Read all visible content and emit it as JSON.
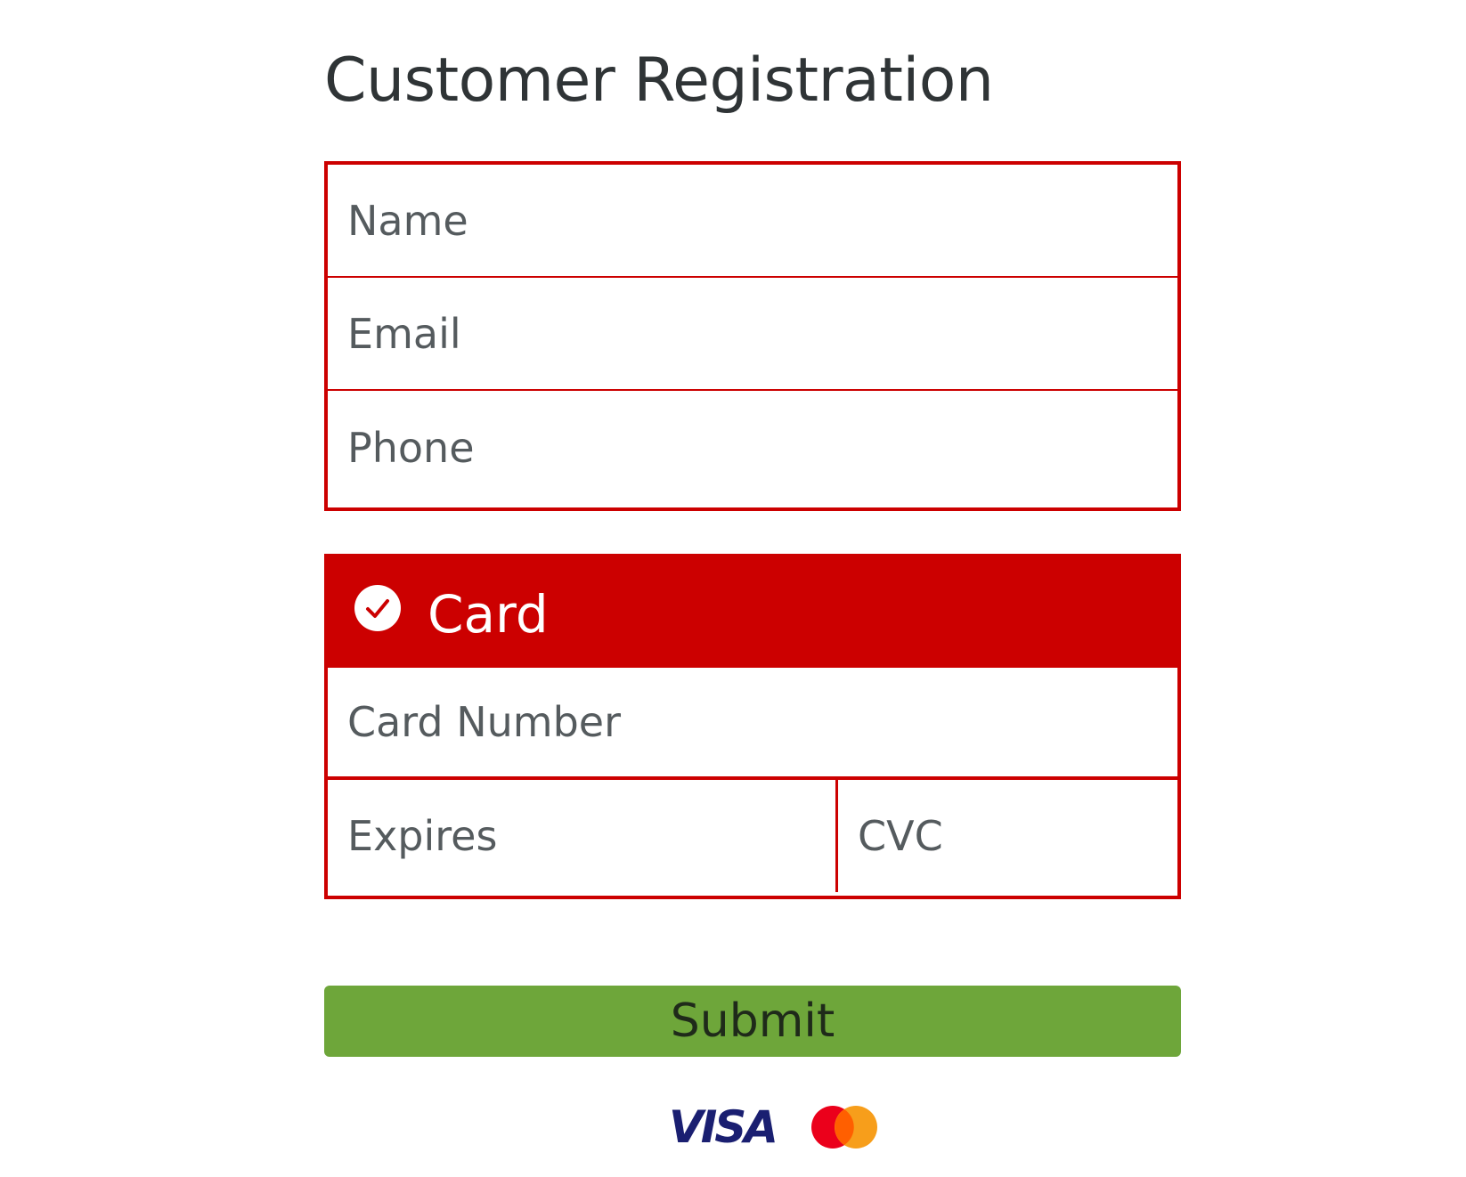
{
  "page": {
    "title": "Customer Registration"
  },
  "contact": {
    "name_placeholder": "Name",
    "email_placeholder": "Email",
    "phone_placeholder": "Phone"
  },
  "card": {
    "header_label": "Card",
    "selected": true,
    "number_placeholder": "Card Number",
    "expires_placeholder": "Expires",
    "cvc_placeholder": "CVC"
  },
  "actions": {
    "submit_label": "Submit"
  },
  "payment_logos": {
    "visa_label": "VISA",
    "mastercard_icon": "mastercard-logo"
  },
  "colors": {
    "accent_red": "#cc0000",
    "submit_green": "#6ea63a",
    "visa_blue": "#1a1f71",
    "mastercard_red": "#eb001b",
    "mastercard_orange": "#f79e1b"
  }
}
